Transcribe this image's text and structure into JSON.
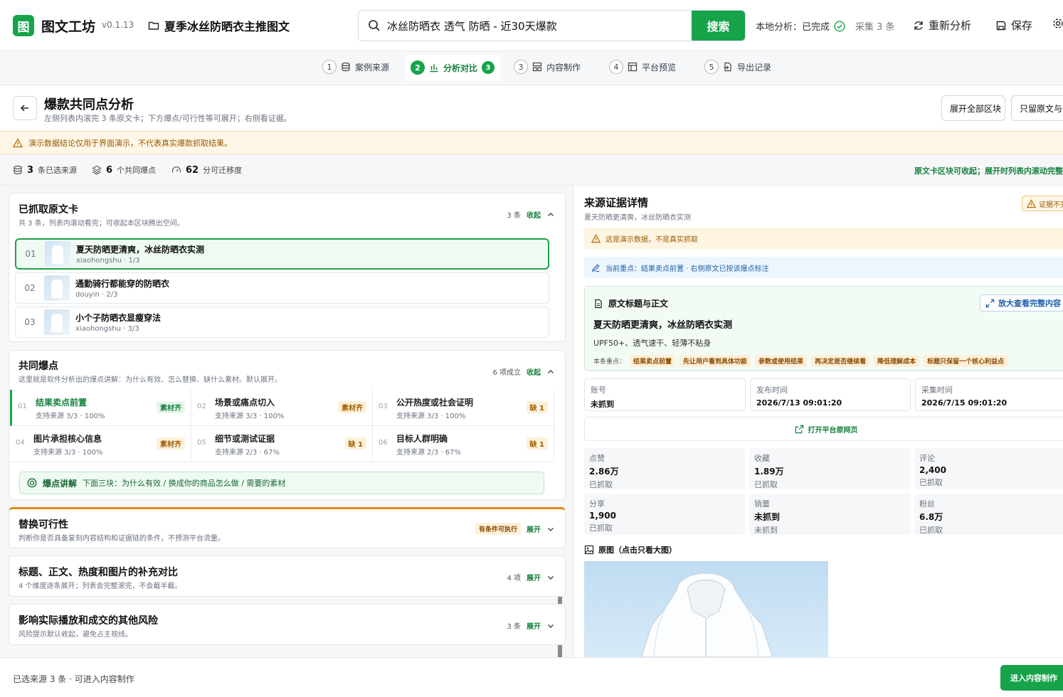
{
  "app": {
    "logo_char": "图",
    "name": "图文工坊",
    "version": "v0.1.13",
    "project": "夏季冰丝防晒衣主推图文"
  },
  "search": {
    "query": "冰丝防晒衣 透气 防晒 - 近30天爆款",
    "button": "搜索"
  },
  "status": {
    "label": "本地分析：已完成",
    "collected": "采集 3 条"
  },
  "toolbar": {
    "reanalyze": "重新分析",
    "save": "保存"
  },
  "steps": [
    {
      "num": "1",
      "label": "案例来源"
    },
    {
      "num": "2",
      "label": "分析对比",
      "badge": "3"
    },
    {
      "num": "3",
      "label": "内容制作"
    },
    {
      "num": "4",
      "label": "平台预览"
    },
    {
      "num": "5",
      "label": "导出记录"
    }
  ],
  "page": {
    "title": "爆款共同点分析",
    "subtitle": "左侧列表内滚完 3 条原文卡；下方爆点/可行性等可展开；右侧看证据。",
    "expand_all": "展开全部区块",
    "keep_only": "只留原文与证据"
  },
  "warning": "演示数据结论仅用于界面演示，不代表真实爆款抓取结果。",
  "metrics": {
    "sources_num": "3",
    "sources_label": "条已选来源",
    "points_num": "6",
    "points_label": "个共同爆点",
    "score_num": "62",
    "score_label": "分可迁移度",
    "note": "原文卡区块可收起；展开时列表内滚动完整"
  },
  "cards": {
    "title": "已抓取原文卡",
    "subtitle": "共 3 条，列表内滚动看完；可收起本区块腾出空间。",
    "count": "3 条",
    "toggle": "收起",
    "items": [
      {
        "idx": "01",
        "title": "夏天防晒更清爽，冰丝防晒衣实测",
        "meta": "xiaohongshu · 1/3"
      },
      {
        "idx": "02",
        "title": "通勤骑行都能穿的防晒衣",
        "meta": "douyin · 2/3"
      },
      {
        "idx": "03",
        "title": "小个子防晒衣显瘦穿法",
        "meta": "xiaohongshu · 3/3"
      }
    ]
  },
  "hooks": {
    "title": "共同爆点",
    "subtitle": "这里就是软件分析出的爆点讲解：为什么有效、怎么替换、缺什么素材。默认展开。",
    "count": "6 项成立",
    "toggle": "收起",
    "items": [
      {
        "idx": "01",
        "name": "结果卖点前置",
        "support": "支持来源 3/3 · 100%",
        "tag": "素材齐",
        "status": "ok"
      },
      {
        "idx": "02",
        "name": "场景或痛点切入",
        "support": "支持来源 3/3 · 100%",
        "tag": "素材齐",
        "status": "warn"
      },
      {
        "idx": "03",
        "name": "公开热度或社会证明",
        "support": "支持来源 3/3 · 100%",
        "tag": "缺 1",
        "status": "warn"
      },
      {
        "idx": "04",
        "name": "图片承担核心信息",
        "support": "支持来源 3/3 · 100%",
        "tag": "素材齐",
        "status": "warn"
      },
      {
        "idx": "05",
        "name": "细节或测试证据",
        "support": "支持来源 2/3 · 67%",
        "tag": "缺 1",
        "status": "warn"
      },
      {
        "idx": "06",
        "name": "目标人群明确",
        "support": "支持来源 2/3 · 67%",
        "tag": "缺 1",
        "status": "warn"
      }
    ],
    "explain_title": "爆点讲解",
    "explain_text": "下面三块：为什么有效 / 换成你的商品怎么做 / 需要的素材"
  },
  "feasibility": {
    "title": "替换可行性",
    "subtitle": "判断你是否具备复刻内容结构和证据链的条件，不预测平台流量。",
    "badge": "有条件可执行",
    "toggle": "展开"
  },
  "compare": {
    "title": "标题、正文、热度和图片的补充对比",
    "subtitle": "4 个维度逐条展开；列表会完整滚完，不会截半截。",
    "count": "4 项",
    "toggle": "展开"
  },
  "risks": {
    "title": "影响实际播放和成交的其他风险",
    "subtitle": "风险提示默认收起，避免占主视线。",
    "count": "3 条",
    "toggle": "展开"
  },
  "evidence": {
    "title": "来源证据详情",
    "subtitle": "夏天防晒更清爽，冰丝防晒衣实测",
    "badge": "证据不完整",
    "warn": "这是演示数据，不是真实抓取",
    "focus": "当前重点：结果卖点前置 · 右侧原文已按该爆点标注",
    "orig_header": "原文标题与正文",
    "zoom": "放大查看完整内容",
    "orig_title": "夏天防晒更清爽，冰丝防晒衣实测",
    "orig_body": "UPF50+、透气速干、轻薄不粘身",
    "key_label": "本条重点：",
    "key_chips": [
      "结果卖点前置",
      "先让用户看到具体功能",
      "参数或使用结果",
      "再决定是否继续看",
      "降低理解成本",
      "标题只保留一个核心利益点"
    ],
    "info": [
      {
        "k": "账号",
        "v": "未抓到"
      },
      {
        "k": "发布时间",
        "v": "2026/7/13 09:01:20"
      },
      {
        "k": "采集时间",
        "v": "2026/7/15 09:01:20"
      }
    ],
    "open_link": "打开平台原网页",
    "stats": [
      {
        "k": "点赞",
        "v": "2.86万",
        "s": "已抓取"
      },
      {
        "k": "收藏",
        "v": "1.89万",
        "s": "已抓取"
      },
      {
        "k": "评论",
        "v": "2,400",
        "s": "已抓取"
      },
      {
        "k": "分享",
        "v": "1,900",
        "s": "已抓取"
      },
      {
        "k": "销量",
        "v": "未抓到",
        "s": "未抓到"
      },
      {
        "k": "粉丝",
        "v": "6.8万",
        "s": "已抓取"
      }
    ],
    "image_header": "原图（点击只看大图）"
  },
  "footer": {
    "text": "已选来源 3 条 · 可进入内容制作",
    "button": "进入内容制作"
  },
  "colors": {
    "accent": "#16a34a",
    "warn": "#9a5b00",
    "info": "#1d5fa8"
  }
}
